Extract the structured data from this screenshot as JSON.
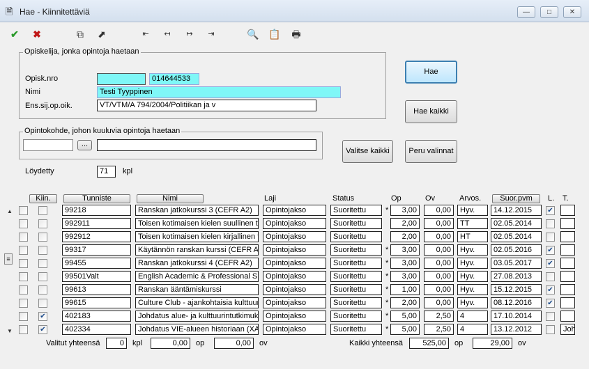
{
  "window": {
    "title": "Hae - Kiinnitettäviä",
    "minimize": "—",
    "maximize": "□",
    "close": "✕"
  },
  "toolbar": [
    "ok-icon",
    "cancel-icon",
    "copy-icon",
    "goto-icon",
    "nav-first-icon",
    "nav-prev-icon",
    "nav-next-icon",
    "nav-last-icon",
    "search-icon",
    "notes-icon",
    "print-icon"
  ],
  "student_group": {
    "title": "Opiskelija, jonka opintoja haetaan",
    "opisknro_label": "Opisk.nro",
    "opisknro_prefix": "",
    "opisknro_value": "014644533",
    "nimi_label": "Nimi",
    "nimi_value": "Testi Tyyppinen",
    "ens_label": "Ens.sij.op.oik.",
    "ens_value": "VT/VTM/A 794/2004/Politiikan ja v"
  },
  "buttons": {
    "hae": "Hae",
    "hae_kaikki": "Hae kaikki",
    "valitse_kaikki": "Valitse kaikki",
    "peru_valinnat": "Peru valinnat",
    "browse": "..."
  },
  "target_group": {
    "title": "Opintokohde, johon kuuluvia opintoja haetaan",
    "code": "",
    "name": ""
  },
  "found": {
    "label": "Löydetty",
    "count": "71",
    "unit": "kpl"
  },
  "columns": {
    "kiin": "Kiin.",
    "tunniste": "Tunniste",
    "nimi": "Nimi",
    "laji": "Laji",
    "status": "Status",
    "op": "Op",
    "ov": "Ov",
    "arvos": "Arvos.",
    "suorpvm": "Suor.pvm",
    "l": "L.",
    "t": "T."
  },
  "rows": [
    {
      "sel": false,
      "kiin": false,
      "tunniste": "99218",
      "nimi": "Ranskan jatkokurssi 3 (CEFR A2)",
      "laji": "Opintojakso",
      "status": "Suoritettu",
      "star": "*",
      "op": "3,00",
      "ov": "0,00",
      "arvos": "Hyv.",
      "pvm": "14.12.2015",
      "l": true,
      "t": ""
    },
    {
      "sel": false,
      "kiin": false,
      "tunniste": "992911",
      "nimi": "Toisen kotimaisen kielen suullinen taito",
      "laji": "Opintojakso",
      "status": "Suoritettu",
      "star": "",
      "op": "2,00",
      "ov": "0,00",
      "arvos": "TT",
      "pvm": "02.05.2014",
      "l": false,
      "t": ""
    },
    {
      "sel": false,
      "kiin": false,
      "tunniste": "992912",
      "nimi": "Toisen kotimaisen kielen kirjallinen taito",
      "laji": "Opintojakso",
      "status": "Suoritettu",
      "star": "",
      "op": "2,00",
      "ov": "0,00",
      "arvos": "HT",
      "pvm": "02.05.2014",
      "l": false,
      "t": ""
    },
    {
      "sel": false,
      "kiin": false,
      "tunniste": "99317",
      "nimi": "Käytännön ranskan kurssi (CEFR A",
      "laji": "Opintojakso",
      "status": "Suoritettu",
      "star": "*",
      "op": "3,00",
      "ov": "0,00",
      "arvos": "Hyv.",
      "pvm": "02.05.2016",
      "l": true,
      "t": ""
    },
    {
      "sel": false,
      "kiin": false,
      "tunniste": "99455",
      "nimi": "Ranskan jatkokurssi 4 (CEFR A2)",
      "laji": "Opintojakso",
      "status": "Suoritettu",
      "star": "*",
      "op": "3,00",
      "ov": "0,00",
      "arvos": "Hyv.",
      "pvm": "03.05.2017",
      "l": true,
      "t": ""
    },
    {
      "sel": false,
      "kiin": false,
      "tunniste": "99501Valt",
      "nimi": "English Academic & Professional Sk",
      "laji": "Opintojakso",
      "status": "Suoritettu",
      "star": "*",
      "op": "3,00",
      "ov": "0,00",
      "arvos": "Hyv.",
      "pvm": "27.08.2013",
      "l": false,
      "t": ""
    },
    {
      "sel": false,
      "kiin": false,
      "tunniste": "99613",
      "nimi": "Ranskan ääntämiskurssi",
      "laji": "Opintojakso",
      "status": "Suoritettu",
      "star": "*",
      "op": "1,00",
      "ov": "0,00",
      "arvos": "Hyv.",
      "pvm": "15.12.2015",
      "l": true,
      "t": ""
    },
    {
      "sel": false,
      "kiin": false,
      "tunniste": "99615",
      "nimi": "Culture Club - ajankohtaisia kulttuuri",
      "laji": "Opintojakso",
      "status": "Suoritettu",
      "star": "*",
      "op": "2,00",
      "ov": "0,00",
      "arvos": "Hyv.",
      "pvm": "08.12.2016",
      "l": true,
      "t": ""
    },
    {
      "sel": false,
      "kiin": true,
      "tunniste": "402183",
      "nimi": "Johdatus alue- ja kulttuurintutkimukseen",
      "laji": "Opintojakso",
      "status": "Suoritettu",
      "star": "*",
      "op": "5,00",
      "ov": "2,50",
      "arvos": "4",
      "pvm": "17.10.2014",
      "l": false,
      "t": ""
    },
    {
      "sel": false,
      "kiin": true,
      "tunniste": "402334",
      "nimi": "Johdatus VIE-alueen historiaan (XA",
      "laji": "Opintojakso",
      "status": "Suoritettu",
      "star": "*",
      "op": "5,00",
      "ov": "2,50",
      "arvos": "4",
      "pvm": "13.12.2012",
      "l": false,
      "t": "Joh"
    }
  ],
  "totals": {
    "valitut_label": "Valitut yhteensä",
    "valitut_count": "0",
    "kpl": "kpl",
    "valitut_op": "0,00",
    "op": "op",
    "valitut_ov": "0,00",
    "ov": "ov",
    "kaikki_label": "Kaikki yhteensä",
    "kaikki_op": "525,00",
    "kaikki_ov": "29,00"
  }
}
